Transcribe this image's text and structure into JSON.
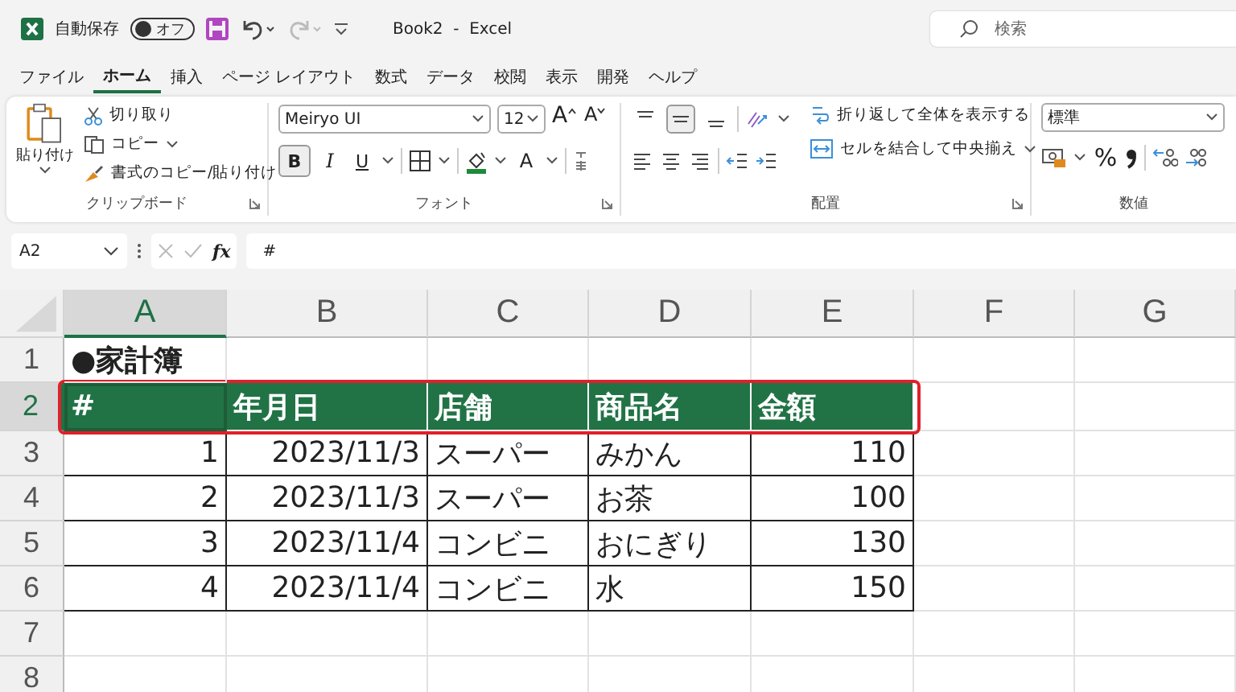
{
  "titlebar": {
    "autosave_label": "自動保存",
    "autosave": {
      "label": "オフ",
      "on": false
    },
    "title": "Book2  -  Excel",
    "search": {
      "placeholder": "検索"
    }
  },
  "ribbon_tabs": [
    {
      "label": "ファイル",
      "selected": false
    },
    {
      "label": "ホーム",
      "selected": true
    },
    {
      "label": "挿入",
      "selected": false
    },
    {
      "label": "ページ レイアウト",
      "selected": false
    },
    {
      "label": "数式",
      "selected": false
    },
    {
      "label": "データ",
      "selected": false
    },
    {
      "label": "校閲",
      "selected": false
    },
    {
      "label": "表示",
      "selected": false
    },
    {
      "label": "開発",
      "selected": false
    },
    {
      "label": "ヘルプ",
      "selected": false
    }
  ],
  "clipboard": {
    "paste": "貼り付け",
    "cut": "切り取り",
    "copy": "コピー",
    "format_painter": "書式のコピー/貼り付け",
    "title": "クリップボード"
  },
  "font": {
    "family": "Meiryo UI",
    "size": "12",
    "grow": "A",
    "shrink": "A",
    "bold": {
      "label": "B",
      "on": true
    },
    "italic": {
      "label": "I",
      "on": false
    },
    "underline": {
      "label": "U",
      "on": false
    },
    "font_color": "A",
    "title": "フォント"
  },
  "alignment": {
    "vertical": [
      {
        "kind": "top",
        "selected": false
      },
      {
        "kind": "middle",
        "selected": true
      },
      {
        "kind": "bottom",
        "selected": false
      }
    ],
    "wrap": "折り返して全体を表示する",
    "merge": "セルを結合して中央揃え",
    "title": "配置"
  },
  "number": {
    "format": "標準",
    "percent": "%",
    "title": "数値"
  },
  "formula_bar": {
    "name_box": "A2",
    "fx": "fx",
    "formula": "#"
  },
  "sheet": {
    "columns": [
      {
        "label": "A",
        "selected": true
      },
      {
        "label": "B",
        "selected": false
      },
      {
        "label": "C",
        "selected": false
      },
      {
        "label": "D",
        "selected": false
      },
      {
        "label": "E",
        "selected": false
      },
      {
        "label": "F",
        "selected": false
      },
      {
        "label": "G",
        "selected": false
      }
    ],
    "rows": [
      {
        "label": "1",
        "selected": false,
        "annotated": false,
        "cells": [
          {
            "text": "●家計簿",
            "kind": "title"
          }
        ]
      },
      {
        "label": "2",
        "selected": true,
        "annotated": true,
        "cells": [
          {
            "text": "#",
            "kind": "header"
          },
          {
            "text": "年月日",
            "kind": "header"
          },
          {
            "text": "店舗",
            "kind": "header"
          },
          {
            "text": "商品名",
            "kind": "header"
          },
          {
            "text": "金額",
            "kind": "header"
          }
        ]
      },
      {
        "label": "3",
        "selected": false,
        "annotated": false,
        "cells": [
          {
            "text": "1",
            "kind": "number"
          },
          {
            "text": "2023/11/3",
            "kind": "number"
          },
          {
            "text": "スーパー",
            "kind": "text"
          },
          {
            "text": "みかん",
            "kind": "text"
          },
          {
            "text": "110",
            "kind": "number"
          }
        ]
      },
      {
        "label": "4",
        "selected": false,
        "annotated": false,
        "cells": [
          {
            "text": "2",
            "kind": "number"
          },
          {
            "text": "2023/11/3",
            "kind": "number"
          },
          {
            "text": "スーパー",
            "kind": "text"
          },
          {
            "text": "お茶",
            "kind": "text"
          },
          {
            "text": "100",
            "kind": "number"
          }
        ]
      },
      {
        "label": "5",
        "selected": false,
        "annotated": false,
        "cells": [
          {
            "text": "3",
            "kind": "number"
          },
          {
            "text": "2023/11/4",
            "kind": "number"
          },
          {
            "text": "コンビニ",
            "kind": "text"
          },
          {
            "text": "おにぎり",
            "kind": "text"
          },
          {
            "text": "130",
            "kind": "number"
          }
        ]
      },
      {
        "label": "6",
        "selected": false,
        "annotated": false,
        "cells": [
          {
            "text": "4",
            "kind": "number"
          },
          {
            "text": "2023/11/4",
            "kind": "number"
          },
          {
            "text": "コンビニ",
            "kind": "text"
          },
          {
            "text": "水",
            "kind": "text"
          },
          {
            "text": "150",
            "kind": "number"
          }
        ]
      },
      {
        "label": "7",
        "selected": false,
        "annotated": false,
        "cells": []
      },
      {
        "label": "8",
        "selected": false,
        "annotated": false,
        "cells": []
      }
    ]
  }
}
